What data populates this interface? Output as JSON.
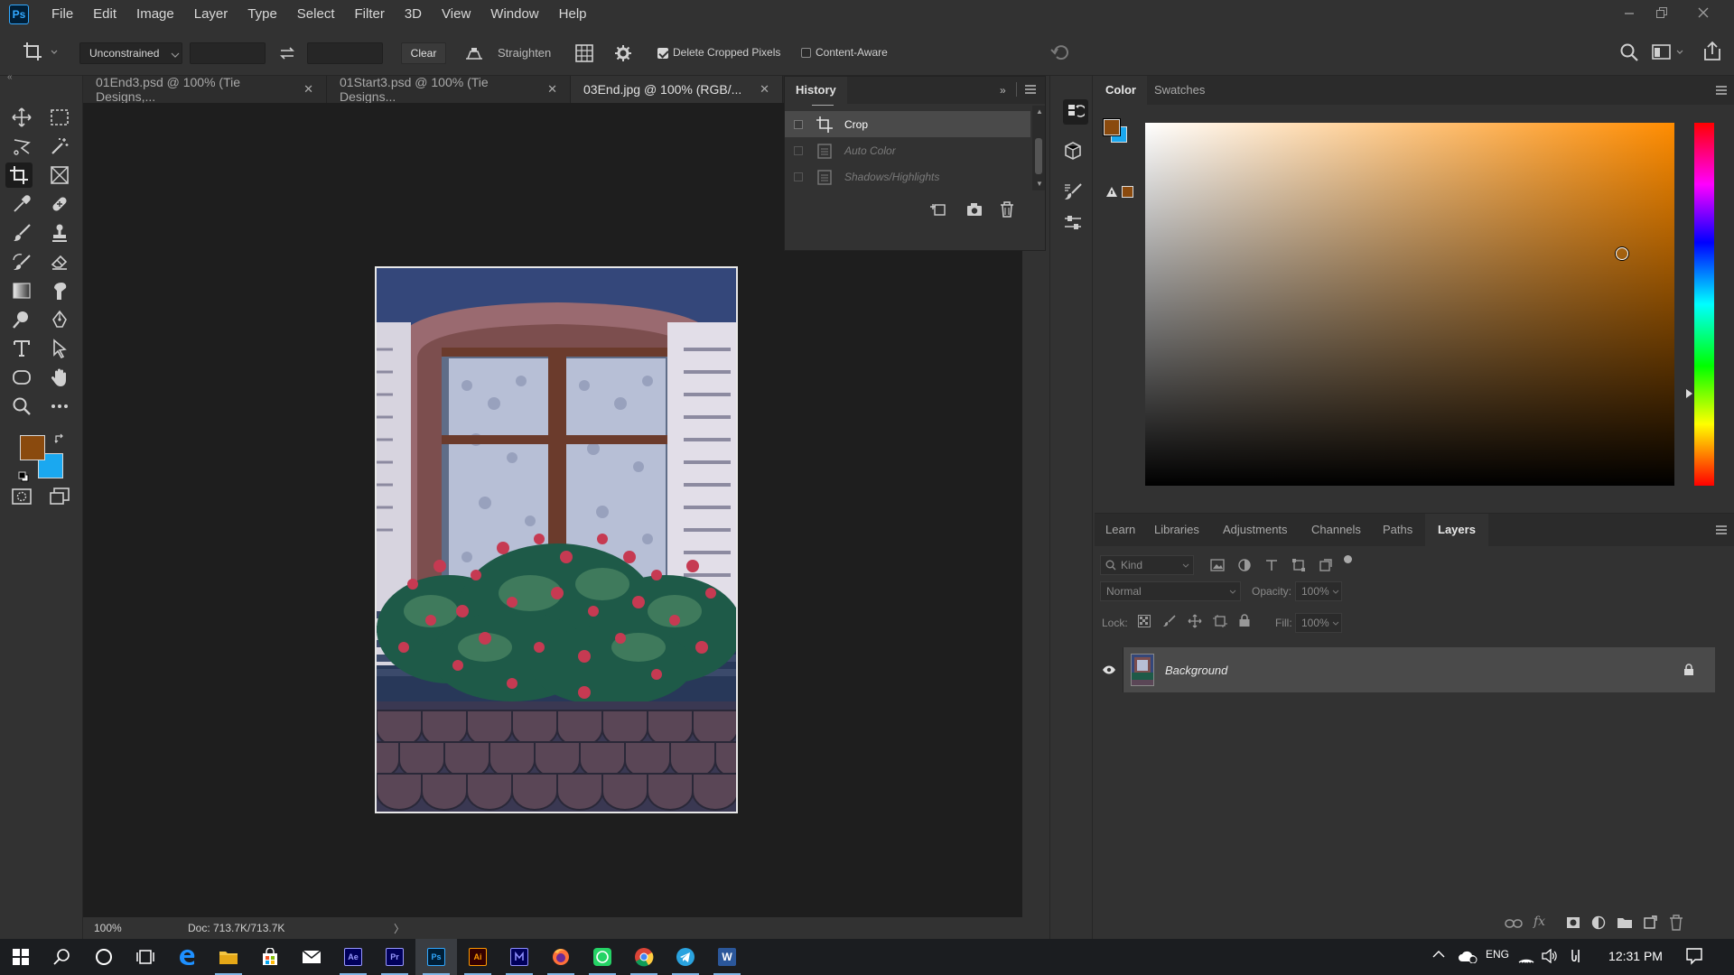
{
  "app": {
    "logo_text": "Ps",
    "accent": "#31a8ff",
    "menu": [
      "File",
      "Edit",
      "Image",
      "Layer",
      "Type",
      "Select",
      "Filter",
      "3D",
      "View",
      "Window",
      "Help"
    ]
  },
  "options": {
    "ratio_preset": "Unconstrained",
    "width_value": "",
    "height_value": "",
    "clear_label": "Clear",
    "straighten_label": "Straighten",
    "delete_cropped_label": "Delete Cropped Pixels",
    "delete_cropped_checked": true,
    "content_aware_label": "Content-Aware",
    "content_aware_checked": false
  },
  "tabs": [
    {
      "label": "01End3.psd @ 100% (Tie Designs,...",
      "active": false
    },
    {
      "label": "01Start3.psd @ 100% (Tie Designs...",
      "active": false
    },
    {
      "label": "03End.jpg @ 100% (RGB/...",
      "active": true
    }
  ],
  "status": {
    "zoom": "100%",
    "doc": "Doc: 713.7K/713.7K"
  },
  "history": {
    "title": "History",
    "items": [
      {
        "label": "Crop",
        "state": "selected"
      },
      {
        "label": "Auto Color",
        "state": "undone"
      },
      {
        "label": "Shadows/Highlights",
        "state": "undone"
      }
    ]
  },
  "colors": {
    "foreground": "#8a4a0e",
    "background": "#1aa8f0"
  },
  "color_panel": {
    "tabs": [
      "Color",
      "Swatches"
    ],
    "active_tab": "Color",
    "base_hue_color": "#ff8c00"
  },
  "layers_panel": {
    "tabs": [
      "Learn",
      "Libraries",
      "Adjustments",
      "Channels",
      "Paths",
      "Layers"
    ],
    "active_tab": "Layers",
    "kind_placeholder": "Kind",
    "blend_mode": "Normal",
    "opacity_label": "Opacity:",
    "opacity_value": "100%",
    "lock_label": "Lock:",
    "fill_label": "Fill:",
    "fill_value": "100%",
    "layers": [
      {
        "name": "Background",
        "visible": true,
        "locked": true
      }
    ]
  },
  "taskbar": {
    "apps": [
      {
        "name": "Edge",
        "label": ""
      },
      {
        "name": "File Explorer",
        "label": ""
      },
      {
        "name": "Store",
        "label": ""
      },
      {
        "name": "Mail",
        "label": ""
      },
      {
        "name": "After Effects",
        "label": "Ae",
        "color": "#9999ff",
        "bg": "#00005b"
      },
      {
        "name": "Premiere Pro",
        "label": "Pr",
        "color": "#9999ff",
        "bg": "#00005b"
      },
      {
        "name": "Photoshop",
        "label": "Ps",
        "color": "#31a8ff",
        "bg": "#001e36"
      },
      {
        "name": "Illustrator",
        "label": "Ai",
        "color": "#ff9a00",
        "bg": "#330000"
      },
      {
        "name": "Media Encoder",
        "label": "",
        "color": "#8f8fff",
        "bg": "#00005b"
      },
      {
        "name": "Firefox",
        "label": ""
      },
      {
        "name": "WhatsApp",
        "label": ""
      },
      {
        "name": "Chrome",
        "label": ""
      },
      {
        "name": "Telegram",
        "label": ""
      },
      {
        "name": "Word",
        "label": "W"
      }
    ],
    "tray_lang": "ENG",
    "time": "12:31 PM"
  }
}
